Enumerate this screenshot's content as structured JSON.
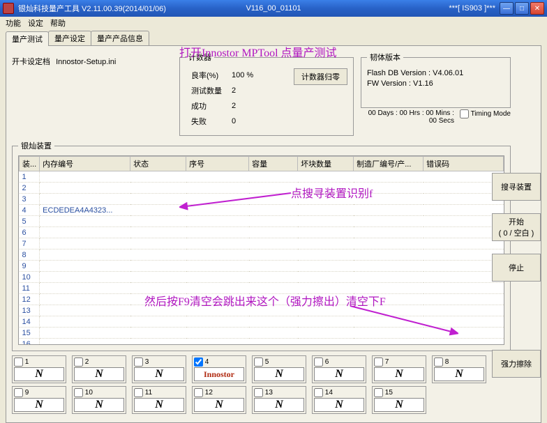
{
  "window": {
    "title_left": "银灿科技量产工具  V2.11.00.39(2014/01/06)",
    "title_center": "V116_00_01101",
    "title_right": "***[ IS903 ]***"
  },
  "menu": {
    "func": "功能",
    "set": "设定",
    "help": "帮助"
  },
  "tabs": {
    "t1": "量产测试",
    "t2": "量产设定",
    "t3": "量产产品信息"
  },
  "cfg": {
    "label": "开卡设定档",
    "file": "Innostor-Setup.ini"
  },
  "counters": {
    "legend": "计数器",
    "rows": {
      "yield_lbl": "良率(%)",
      "yield_val": "100 %",
      "test_lbl": "测试数量",
      "test_val": "2",
      "succ_lbl": "成功",
      "succ_val": "2",
      "fail_lbl": "失败",
      "fail_val": "0"
    },
    "reset": "计数器归零"
  },
  "fw": {
    "legend": "韧体版本",
    "flashdb": "Flash DB Version :   V4.06.01",
    "fwver": "FW Version :   V1.16"
  },
  "elapsed": "00 Days : 00 Hrs : 00 Mins : 00 Secs",
  "timing_mode": "Timing Mode",
  "dev_legend": "银灿装置",
  "cols": {
    "c0": "装...",
    "c1": "内存编号",
    "c2": "状态",
    "c3": "序号",
    "c4": "容量",
    "c5": "坏块数量",
    "c6": "制造厂编号/产...",
    "c7": "错误码"
  },
  "row4_mem": "ECDEDEA4A4323...",
  "rbtn": {
    "find": "搜寻装置",
    "start": "开始\n( 0 / 空白 )",
    "stop": "停止",
    "erase": "强力擦除"
  },
  "annot": {
    "a1": "打开Innostor MPTool   点量产测试",
    "a2": "点搜寻装置识别f",
    "a3": "然后按F9清空会跳出来这个（强力擦出）清空下F"
  },
  "slots": {
    "n_label": "N",
    "inno_label": "Innostor",
    "nums": [
      "1",
      "2",
      "3",
      "4",
      "5",
      "6",
      "7",
      "8",
      "9",
      "10",
      "11",
      "12",
      "13",
      "14",
      "15"
    ],
    "checked_index": 3
  }
}
